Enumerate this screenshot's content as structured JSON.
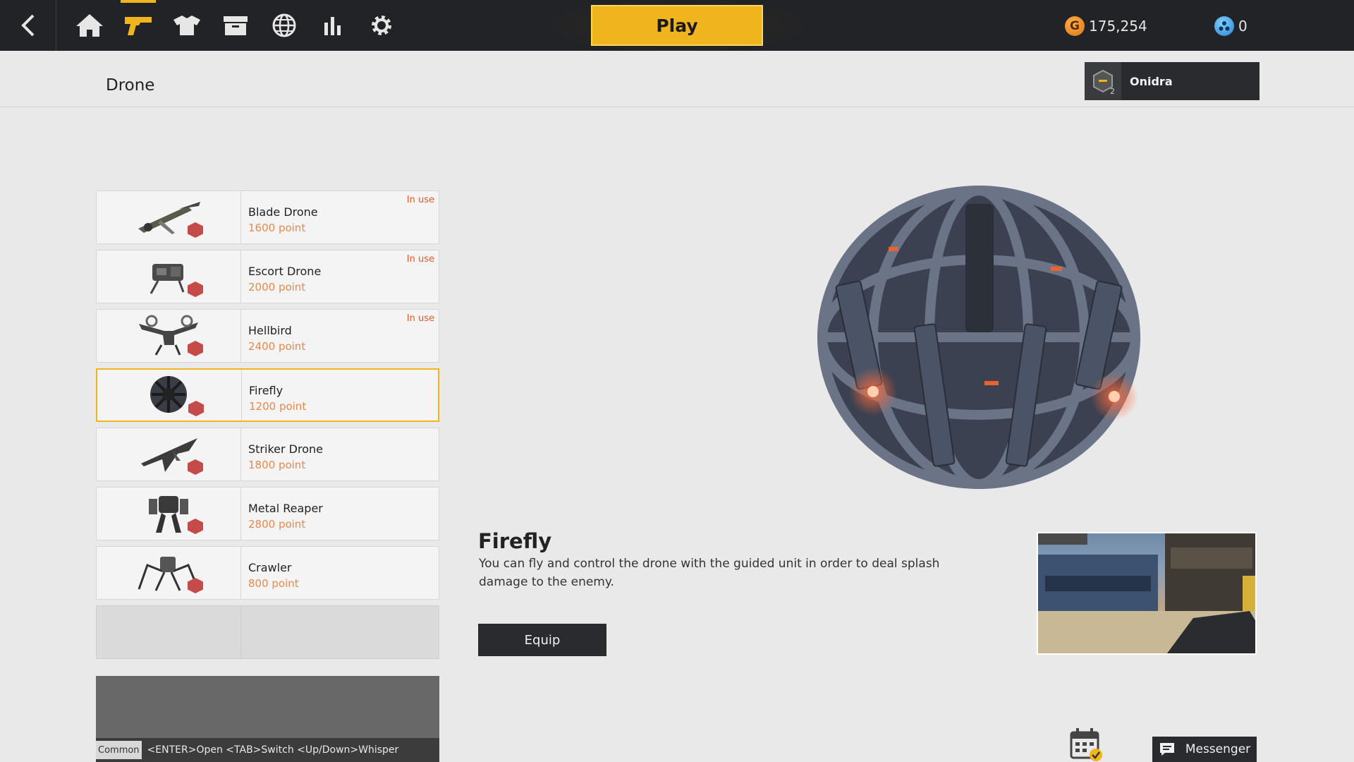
{
  "topbar": {
    "play_label": "Play",
    "gold_amount": "175,254",
    "gold_symbol": "G",
    "blue_amount": "0",
    "nav": [
      "home-icon",
      "weapon-icon",
      "outfit-icon",
      "storage-icon",
      "world-icon",
      "stats-icon",
      "settings-icon"
    ],
    "active_nav": "weapon-icon"
  },
  "page": {
    "title": "Drone"
  },
  "profile": {
    "name": "Onidra",
    "rank": "2"
  },
  "drones": [
    {
      "name": "Blade Drone",
      "price": "1600 point",
      "status": "In use"
    },
    {
      "name": "Escort Drone",
      "price": "2000 point",
      "status": "In use"
    },
    {
      "name": "Hellbird",
      "price": "2400 point",
      "status": "In use"
    },
    {
      "name": "Firefly",
      "price": "1200 point",
      "status": "",
      "selected": true
    },
    {
      "name": "Striker Drone",
      "price": "1800 point",
      "status": ""
    },
    {
      "name": "Metal Reaper",
      "price": "2800 point",
      "status": ""
    },
    {
      "name": "Crawler",
      "price": "800 point",
      "status": ""
    }
  ],
  "detail": {
    "name": "Firefly",
    "description": "You can fly and control the drone with the guided unit in order to deal splash damage to the enemy.",
    "equip_label": "Equip"
  },
  "chat": {
    "channel": "Common",
    "hint": "<ENTER>Open <TAB>Switch <Up/Down>Whisper"
  },
  "messenger_label": "Messenger",
  "colors": {
    "accent": "#f0b41c",
    "price": "#e8884a",
    "in_use": "#e05a2a",
    "topbar": "#222326"
  }
}
